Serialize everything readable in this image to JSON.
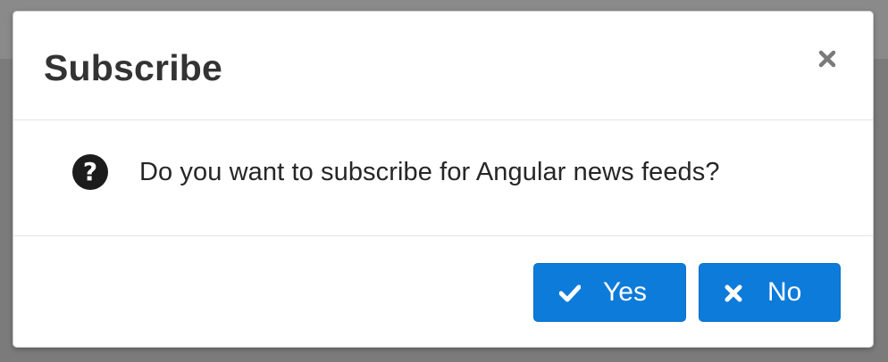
{
  "dialog": {
    "title": "Subscribe",
    "close_icon": "close-icon",
    "message_icon": "question-circle-icon",
    "message": "Do you want to subscribe for Angular news feeds?",
    "buttons": {
      "yes": {
        "label": "Yes",
        "icon": "check-icon"
      },
      "no": {
        "label": "No",
        "icon": "times-icon"
      }
    }
  },
  "colors": {
    "backdrop": "#7b7b7b",
    "dialog_background": "#ffffff",
    "primary_button": "#0d7bd9",
    "title_text": "#333333",
    "body_text": "#262626"
  }
}
